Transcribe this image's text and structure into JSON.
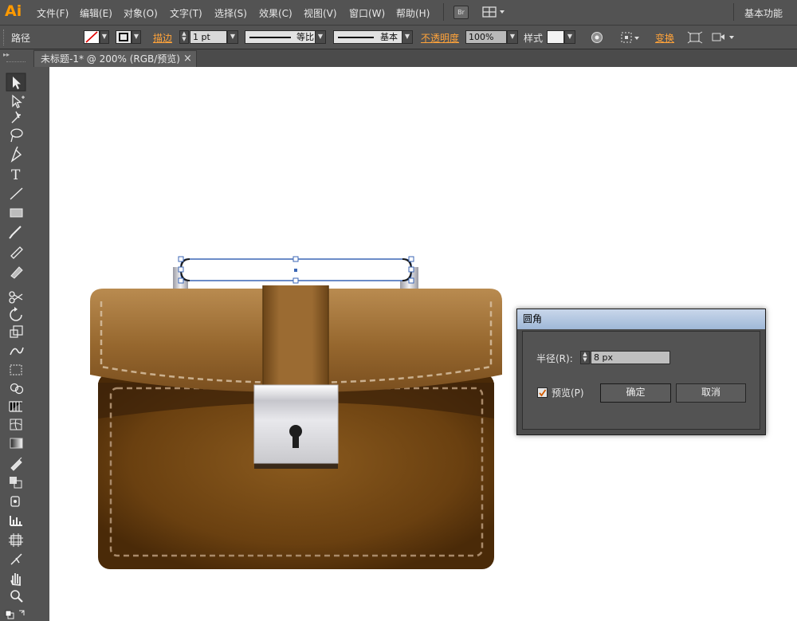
{
  "app": {
    "logo": "Ai",
    "workspace_label": "基本功能"
  },
  "menu": [
    "文件(F)",
    "编辑(E)",
    "对象(O)",
    "文字(T)",
    "选择(S)",
    "效果(C)",
    "视图(V)",
    "窗口(W)",
    "帮助(H)"
  ],
  "menu_icons": {
    "bridge_label": "Br"
  },
  "control": {
    "selection_label": "路径",
    "stroke_label": "描边",
    "stroke_weight": "1 pt",
    "profile_label": "等比",
    "brush_label": "基本",
    "opacity_label": "不透明度",
    "opacity_value": "100%",
    "style_label": "样式",
    "transform_label": "变换"
  },
  "document": {
    "tab_title": "未标题-1* @ 200% (RGB/预览)",
    "tab_close": "×"
  },
  "dialog": {
    "title": "圆角",
    "radius_label": "半径(R):",
    "radius_value": "8 px",
    "preview_label": "预览(P)",
    "preview_checked": true,
    "ok_label": "确定",
    "cancel_label": "取消"
  },
  "colors": {
    "accent_orange": "#ff9a00",
    "ui_gray": "#535353",
    "briefcase_brown": "#8a5a22",
    "selection_blue": "#3b66b5"
  },
  "tools": [
    "selection-tool",
    "direct-selection-tool",
    "magic-wand-tool",
    "lasso-tool",
    "pen-tool",
    "type-tool",
    "line-tool",
    "rectangle-tool",
    "paintbrush-tool",
    "pencil-tool",
    "blob-brush-tool",
    "scissors-tool",
    "rotate-tool",
    "scale-tool",
    "warp-tool",
    "free-transform-tool",
    "shape-builder-tool",
    "perspective-grid-tool",
    "mesh-tool",
    "gradient-tool",
    "eyedropper-tool",
    "blend-tool",
    "symbol-sprayer-tool",
    "column-graph-tool",
    "artboard-tool",
    "slice-tool",
    "hand-tool",
    "zoom-tool"
  ]
}
